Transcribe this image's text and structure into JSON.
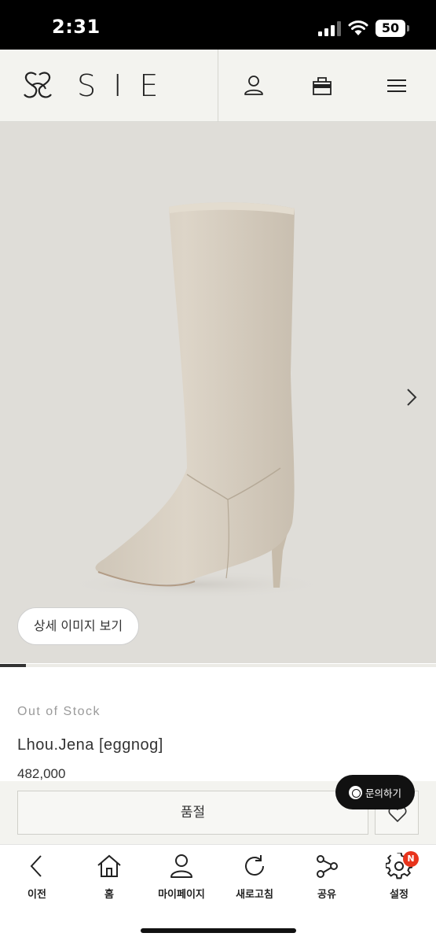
{
  "status_bar": {
    "time": "2:31",
    "battery": "50"
  },
  "header": {
    "brand": "SIE"
  },
  "product": {
    "detail_button_label": "상세 이미지 보기",
    "stock_status": "Out of Stock",
    "name": "Lhou.Jena [eggnog]",
    "price": "482,000",
    "image_slide_progress": 0.06
  },
  "chat": {
    "label": "문의하기"
  },
  "purchase": {
    "soldout_label": "품절"
  },
  "toolbar": {
    "items": [
      {
        "label": "이전",
        "icon": "back-arrow-icon"
      },
      {
        "label": "홈",
        "icon": "home-icon"
      },
      {
        "label": "마이페이지",
        "icon": "person-icon"
      },
      {
        "label": "새로고침",
        "icon": "refresh-icon"
      },
      {
        "label": "공유",
        "icon": "share-icon"
      },
      {
        "label": "설정",
        "icon": "gear-icon",
        "badge": "N"
      }
    ]
  },
  "colors": {
    "header_bg": "#f3f3ef",
    "badge": "#e8341c",
    "chat_bg": "#111111"
  }
}
